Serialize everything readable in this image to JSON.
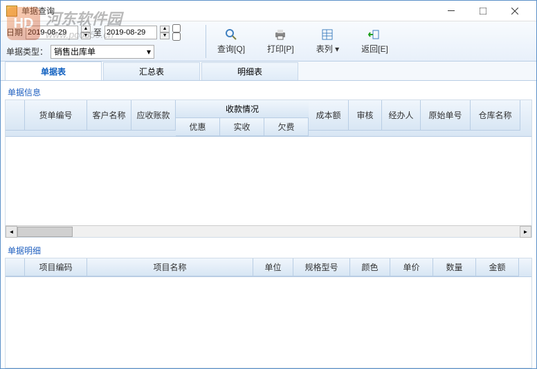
{
  "window": {
    "title": "单据查询"
  },
  "toolbar": {
    "date_label": "日期",
    "date_from": "2019-08-29",
    "date_to_label": "至",
    "date_to": "2019-08-29",
    "type_label": "单据类型：",
    "type_value": "销售出库单",
    "buttons": {
      "query": "查询[Q]",
      "print": "打印[P]",
      "list": "表列",
      "back": "返回[E]"
    }
  },
  "tabs": {
    "t0": "单据表",
    "t1": "汇总表",
    "t2": "明细表"
  },
  "panel1": {
    "title": "单据信息",
    "cols": {
      "bill_no": "货单编号",
      "customer": "客户名称",
      "receivable": "应收账款",
      "collection_group": "收款情况",
      "discount": "优惠",
      "received": "实收",
      "arrears": "欠费",
      "cost": "成本额",
      "audit": "审核",
      "handler": "经办人",
      "orig_no": "原始单号",
      "warehouse": "仓库名称"
    }
  },
  "panel2": {
    "title": "单据明细",
    "cols": {
      "code": "项目编码",
      "name": "项目名称",
      "unit": "单位",
      "spec": "规格型号",
      "color": "颜色",
      "price": "单价",
      "qty": "数量",
      "amount": "金额"
    }
  },
  "watermark": {
    "icon_text": "HD",
    "title": "河东软件园",
    "url": "www.pc0359.cn"
  }
}
